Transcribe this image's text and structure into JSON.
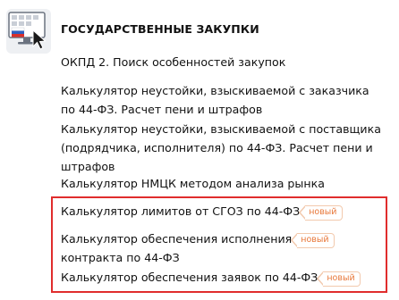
{
  "section": {
    "title": "ГОСУДАРСТВЕННЫЕ ЗАКУПКИ",
    "logo_icon": "monitor-flag-cursor-icon"
  },
  "menu": {
    "items": [
      {
        "line1": "ОКПД 2. Поиск особенностей закупок"
      },
      {
        "line1": "Калькулятор неустойки, взыскиваемой с заказчика",
        "line2": "по 44-ФЗ. Расчет пени и штрафов"
      },
      {
        "line1": "Калькулятор неустойки, взыскиваемой с поставщика",
        "line2": "(подрядчика, исполнителя) по 44-ФЗ. Расчет пени и",
        "line3": "штрафов"
      },
      {
        "line1": "Калькулятор НМЦК методом анализа рынка"
      },
      {
        "line1": "Калькулятор лимитов от СГОЗ по 44-ФЗ",
        "badge": "новый"
      },
      {
        "line1": "Калькулятор обеспечения исполнения",
        "line2": "контракта по 44-ФЗ",
        "badge": "новый"
      },
      {
        "line1": "Калькулятор обеспечения заявок по 44-ФЗ",
        "badge": "новый"
      }
    ]
  },
  "colors": {
    "highlight": "#e02d2d",
    "badge_text": "#e8783a",
    "badge_border": "#f2c9ad"
  }
}
